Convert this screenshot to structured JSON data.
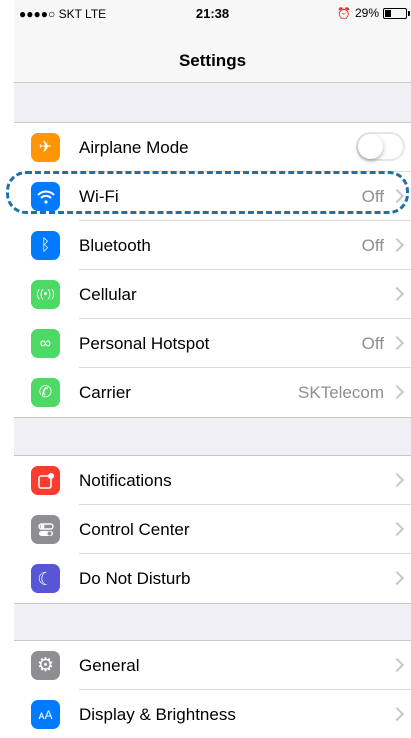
{
  "status_bar": {
    "carrier": "●●●●○ SKT  LTE",
    "time": "21:38",
    "alarm_icon": "alarm-clock-icon",
    "battery": "29%",
    "battery_level": 0.29
  },
  "nav": {
    "title": "Settings"
  },
  "groups": [
    {
      "rows": [
        {
          "label": "Airplane Mode",
          "icon": "airplane-icon",
          "color": "#ff9500",
          "glyph": "✈",
          "toggle": false
        },
        {
          "label": "Wi-Fi",
          "icon": "wifi-icon",
          "color": "#007aff",
          "glyph": "◠",
          "value": "Off"
        },
        {
          "label": "Bluetooth",
          "icon": "bluetooth-icon",
          "color": "#007aff",
          "glyph": "ᛒ",
          "value": "Off"
        },
        {
          "label": "Cellular",
          "icon": "cellular-icon",
          "color": "#4cd964",
          "glyph": "((·))",
          "value": ""
        },
        {
          "label": "Personal Hotspot",
          "icon": "hotspot-icon",
          "color": "#4cd964",
          "glyph": "∞",
          "value": "Off"
        },
        {
          "label": "Carrier",
          "icon": "phone-icon",
          "color": "#4cd964",
          "glyph": "✆",
          "value": "SKTelecom"
        }
      ]
    },
    {
      "rows": [
        {
          "label": "Notifications",
          "icon": "notifications-icon",
          "color": "#ff3b30",
          "glyph": "▢",
          "value": ""
        },
        {
          "label": "Control Center",
          "icon": "control-center-icon",
          "color": "#8e8e93",
          "glyph": "⚌",
          "value": ""
        },
        {
          "label": "Do Not Disturb",
          "icon": "moon-icon",
          "color": "#5856d6",
          "glyph": "☾",
          "value": ""
        }
      ]
    },
    {
      "rows": [
        {
          "label": "General",
          "icon": "gear-icon",
          "color": "#8e8e93",
          "glyph": "⚙",
          "value": ""
        },
        {
          "label": "Display & Brightness",
          "icon": "display-brightness-icon",
          "color": "#007aff",
          "glyph": "AA",
          "value": ""
        }
      ]
    }
  ]
}
